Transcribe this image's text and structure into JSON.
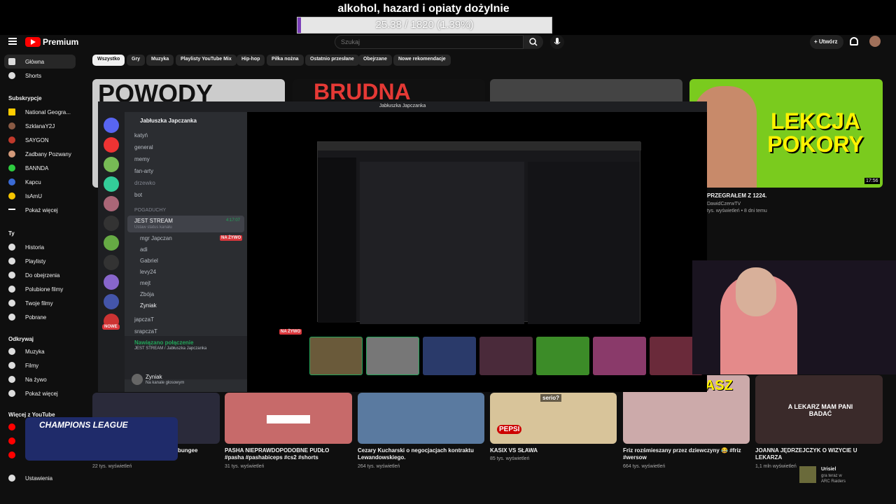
{
  "overlay": {
    "title": "alkohol, hazard i opiaty dożylnie",
    "progress_text": "25.38 / 1820 (1.39%)",
    "progress_fraction": 0.0139
  },
  "header": {
    "logo": "Premium",
    "search_placeholder": "Szukaj",
    "create": "+ Utwórz"
  },
  "chips": [
    "Wszystko",
    "Gry",
    "Muzyka",
    "Playlisty YouTube Mix",
    "Hip-hop",
    "Piłka nożna",
    "Ostatnio przesłane",
    "Obejrzane",
    "Nowe rekomendacje"
  ],
  "sidebar": {
    "home": "Główna",
    "shorts": "Shorts",
    "subs_head": "Subskrypcje",
    "subs": [
      "National Geogra...",
      "SzklanaY2J",
      "SAYGON",
      "Zadbany Pozwany",
      "BANNDA",
      "Kapcu",
      "IsAmU",
      "Pokaż więcej"
    ],
    "you_head": "Ty",
    "you": [
      "Historia",
      "Playlisty",
      "Do obejrzenia",
      "Polubione filmy",
      "Twoje filmy",
      "Pobrane"
    ],
    "explore_head": "Odkrywaj",
    "explore": [
      "Muzyka",
      "Filmy",
      "Na żywo",
      "Pokaż więcej"
    ],
    "more_head": "Więcej z YouTube",
    "settings": "Ustawienia"
  },
  "videos": {
    "v1": {
      "title": "PRZEGRAŁEM Z 1224.",
      "channel": "DawidCzerwTV",
      "meta": "tys. wyświetleń • 8 dni temu",
      "thumb_text": "LEKCJA POKORY",
      "duration": "17:56"
    },
    "r1": {
      "title": "bungee",
      "meta": "22 tys. wyświetleń"
    },
    "r2": {
      "title": "PASHA NIEPRAWDOPODOBNE PUDŁO #pasha #pashabiceps #cs2 #shorts",
      "meta": "31 tys. wyświetleń"
    },
    "r3": {
      "title": "Cezary Kucharski o negocjacjach kontraktu Lewandowskiego.",
      "meta": "264 tys. wyświetleń"
    },
    "r4": {
      "title": "KASIX VS SŁAWA",
      "meta": "85 tys. wyświetleń"
    },
    "r5": {
      "title": "Friz rozśmieszany przez dziewczyny 😂 #friz #wersow",
      "meta": "664 tys. wyświetleń"
    },
    "r6": {
      "title": "JOANNA JĘDRZEJCZYK O WIZYCIE U LEKARZA",
      "meta": "1,1 mln wyświetleń",
      "thumb_text": "A LEKARZ MAM PANI BADAĆ"
    },
    "thumb_words": {
      "a": "POWODY",
      "b": "BRUDNA",
      "c": "CHAMPIONS LEAGUE",
      "d": "WYGRYWASZ",
      "e": "serio?",
      "f": "PEPSI"
    }
  },
  "discord": {
    "window_title": "Jabłuszka Japczanka",
    "server_name": "Jabłuszka Japczanka",
    "channels": [
      "katyń",
      "general",
      "memy",
      "fan-arty",
      "drzewko",
      "bot"
    ],
    "category": "POGADUCHY",
    "voice_channel": "JEST STREAM",
    "voice_time": "4:17:07",
    "voice_status": "Ustaw status kanału",
    "members": [
      "mgr Japczan",
      "adi",
      "Gabriel",
      "levy24",
      "mejt",
      "Zbója",
      "Zyniak"
    ],
    "live_badge": "NA ŻYWO",
    "other_channels": [
      "japczaT",
      "srapczaT"
    ],
    "connected": "Nawiązano połączenie",
    "connected_sub": "JEST STREAM / Jabłuszka Japczanka",
    "user": "Zyniak",
    "user_status": "Na kanale głosowym",
    "new_badge": "NOWE"
  },
  "notif": {
    "name": "Urisiel",
    "line1": "gra teraz w",
    "line2": "ARC Raiders"
  }
}
